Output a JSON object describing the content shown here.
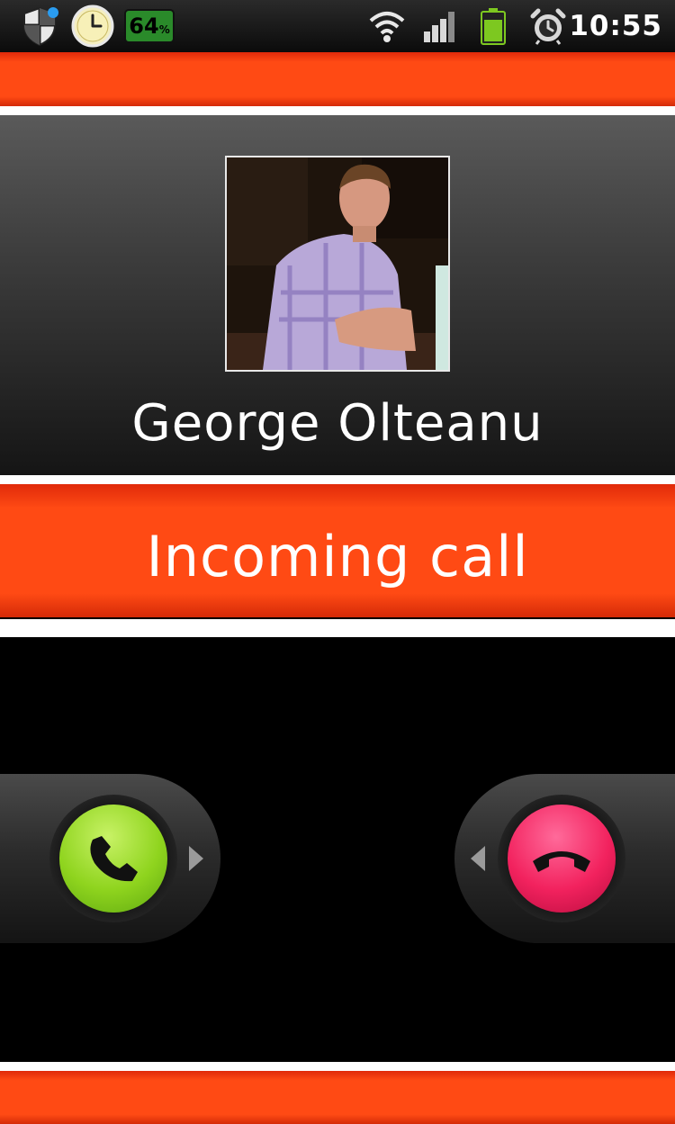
{
  "status_bar": {
    "time": "10:55",
    "battery_percent_badge": "64",
    "battery_percent_symbol": "%",
    "icons": [
      "shield-icon",
      "clock-icon",
      "battery-percent-icon",
      "wifi-icon",
      "signal-icon",
      "battery-icon",
      "alarm-icon"
    ]
  },
  "contact": {
    "name": "George Olteanu"
  },
  "call": {
    "status": "Incoming call"
  },
  "colors": {
    "accent_orange": "#ff4a14",
    "answer_green": "#8fd41e",
    "decline_red": "#f2225e"
  }
}
